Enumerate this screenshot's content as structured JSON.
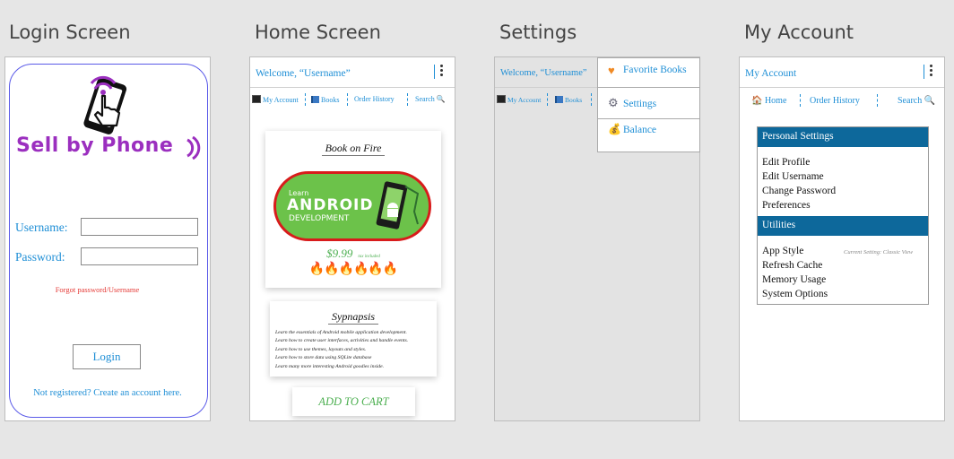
{
  "titles": [
    "Login Screen",
    "Home Screen",
    "Settings",
    "My Account"
  ],
  "login": {
    "brand": "Sell by Phone",
    "username_label": "Username:",
    "password_label": "Password:",
    "username_value": "",
    "password_value": "",
    "forgot": "Forgot password/Username",
    "login_button": "Login",
    "register": "Not registered? Create an account here."
  },
  "home": {
    "welcome": "Welcome, “Username”",
    "nav": [
      "My Account",
      "Books",
      "Order History",
      "Search"
    ],
    "book_title": "Book on Fire",
    "banner_small": "Learn",
    "banner_big": "ANDROID",
    "banner_sub": "DEVELOPMENT",
    "price": "$9.99",
    "tax": "tax included",
    "rating_icons": "🔥🔥🔥🔥🔥🔥",
    "synopsis_title": "Sypnapsis",
    "synopsis_lines": [
      "Learn the essentials of Android mobile application development.",
      "Learn how to create user interfaces, activities and handle events.",
      "Learn how to use themes, layouts and styles.",
      "Learn how to store data using SQLite database",
      "Learn many more interesting Android goodies inside."
    ],
    "add_to_cart": "ADD TO CART"
  },
  "settings": {
    "welcome": "Welcome, “Username”",
    "nav": [
      "My Account",
      "Books"
    ],
    "menu": [
      "Favorite Books",
      "Settings",
      "Balance"
    ]
  },
  "account": {
    "title": "My Account",
    "nav": [
      "Home",
      "Order History",
      "Search"
    ],
    "personal_header": "Personal Settings",
    "personal_items": [
      "Edit Profile",
      "Edit Username",
      "Change Password",
      "Preferences"
    ],
    "utilities_header": "Utilities",
    "utility_items": [
      "App Style",
      "Refresh Cache",
      "Memory Usage",
      "System Options"
    ],
    "current_setting": "Current Setting: Classic View"
  },
  "colors": {
    "link_blue": "#1f8fd6",
    "panel_blue": "#0d689b",
    "brand_purple": "#9b2fbf",
    "forgot_red": "#e53935",
    "price_green": "#4caf50",
    "banner_green": "#6cc24a",
    "banner_red": "#d81b1b"
  }
}
